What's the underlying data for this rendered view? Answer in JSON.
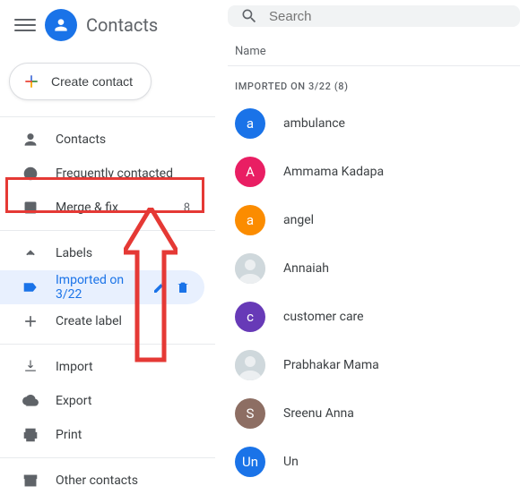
{
  "header": {
    "app_title": "Contacts"
  },
  "create_button": "Create contact",
  "sidebar": {
    "items": [
      {
        "label": "Contacts"
      },
      {
        "label": "Frequently contacted"
      },
      {
        "label": "Merge & fix",
        "badge": "8"
      }
    ],
    "labels_header": "Labels",
    "labels": [
      {
        "label": "Imported on 3/22",
        "selected": true
      }
    ],
    "create_label": "Create label",
    "io": [
      {
        "label": "Import"
      },
      {
        "label": "Export"
      },
      {
        "label": "Print"
      }
    ],
    "other_contacts": "Other contacts"
  },
  "search": {
    "placeholder": "Search"
  },
  "column_header": "Name",
  "group": {
    "label": "IMPORTED ON 3/22 (8)"
  },
  "contacts": [
    {
      "initial": "a",
      "name": "ambulance",
      "color": "#1a73e8"
    },
    {
      "initial": "A",
      "name": "Ammama Kadapa",
      "color": "#e91e63"
    },
    {
      "initial": "a",
      "name": "angel",
      "color": "#fb8c00"
    },
    {
      "initial": "",
      "name": "Annaiah",
      "photo": true
    },
    {
      "initial": "c",
      "name": "customer care",
      "color": "#673ab7"
    },
    {
      "initial": "",
      "name": "Prabhakar Mama",
      "photo": true
    },
    {
      "initial": "S",
      "name": "Sreenu Anna",
      "color": "#8d6e63"
    },
    {
      "initial": "Un",
      "name": "Un",
      "color": "#1a73e8"
    }
  ]
}
